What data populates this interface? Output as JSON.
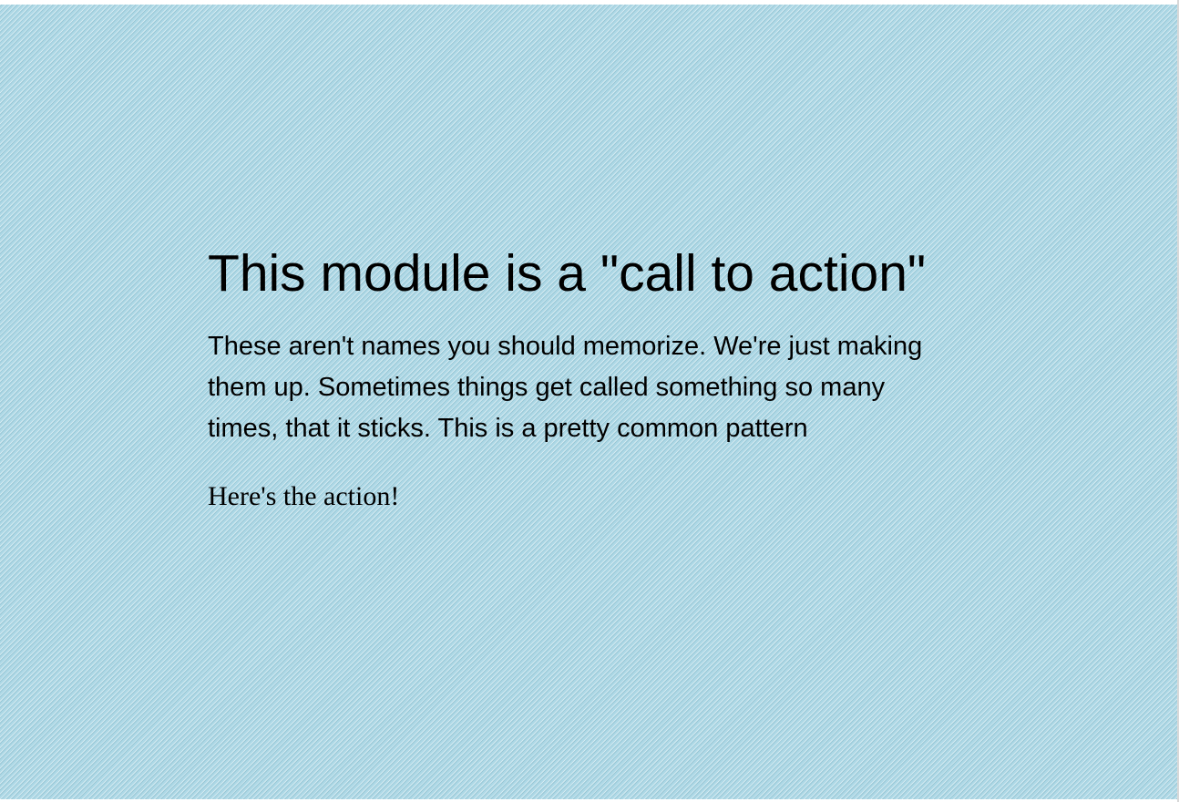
{
  "cta": {
    "heading": "This module is a \"call to action\"",
    "description": "These aren't names you should memorize. We're just making them up. Sometimes things get called something so many times, that it sticks. This is a pretty common pattern",
    "action_label": "Here's the action!"
  },
  "colors": {
    "background": "#add8e6",
    "text": "#000000"
  }
}
